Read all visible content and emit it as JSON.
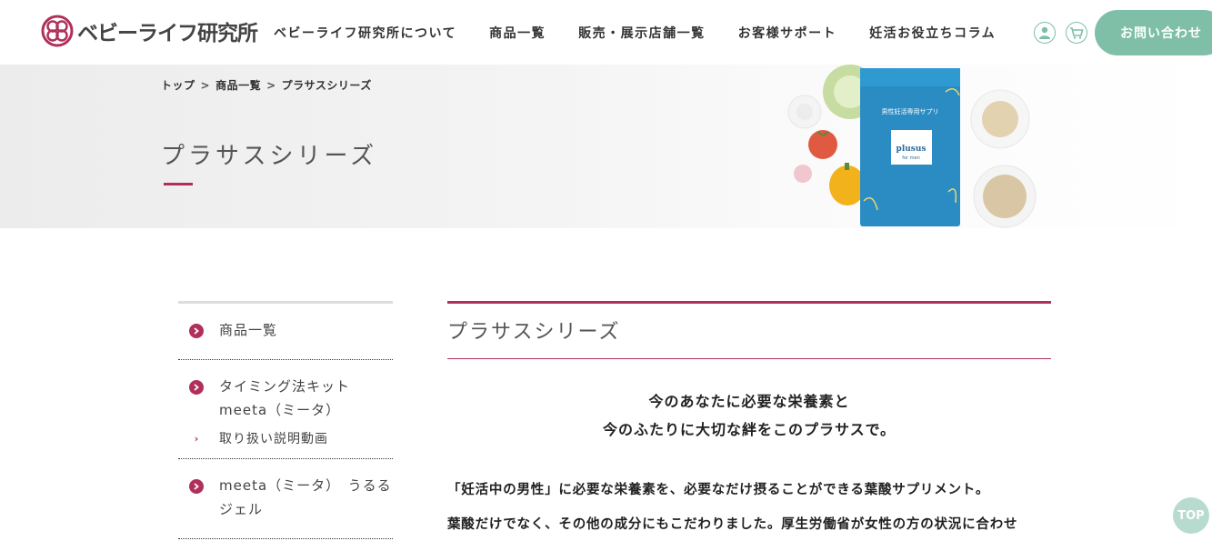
{
  "header": {
    "logo_text": "ベビーライフ研究所",
    "nav": [
      "ベビーライフ研究所について",
      "商品一覧",
      "販売・展示店舗一覧",
      "お客様サポート",
      "妊活お役立ちコラム"
    ],
    "contact_label": "お問い合わせ",
    "icons": [
      "user-icon",
      "cart-icon"
    ]
  },
  "hero": {
    "breadcrumb": [
      "トップ",
      "商品一覧",
      "プラサスシリーズ"
    ],
    "title": "プラサスシリーズ",
    "package_label": "男性妊活専用サプリ",
    "package_brand": "plusus",
    "package_sub": "for men"
  },
  "sidebar": {
    "items": [
      {
        "label": "商品一覧"
      },
      {
        "label": "タイミング法キット meeta（ミータ）",
        "sub": "取り扱い説明動画"
      },
      {
        "label": "meeta（ミータ）　うるるジェル"
      }
    ]
  },
  "main": {
    "title": "プラサスシリーズ",
    "lead_line1": "今のあなたに必要な栄養素と",
    "lead_line2": "今のふたりに大切な絆をこのプラサスで。",
    "para_line1": "「妊活中の男性」に必要な栄養素を、必要なだけ摂ることができる葉酸サプリメント。",
    "para_line2": "葉酸だけでなく、その他の成分にもこだわりました。厚生労働省が女性の方の状況に合わせ"
  },
  "top_button": "TOP",
  "colors": {
    "accent": "#b0305a",
    "green": "#7fbfa8",
    "package_blue": "#2b8cc4"
  }
}
